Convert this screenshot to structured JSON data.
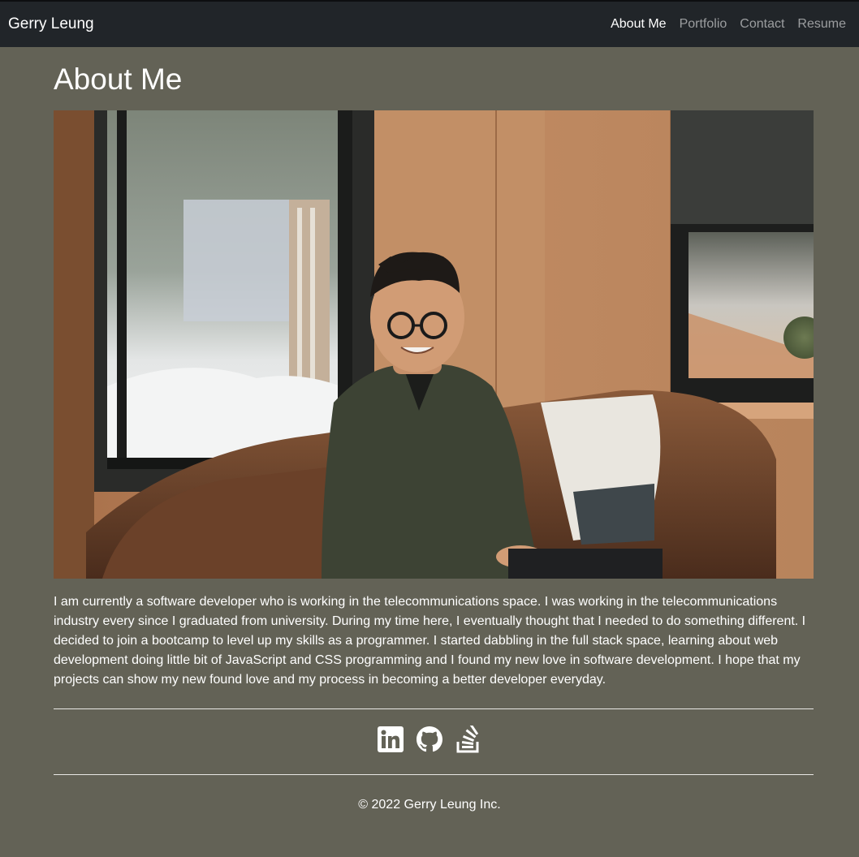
{
  "nav": {
    "brand": "Gerry Leung",
    "links": [
      {
        "label": "About Me"
      },
      {
        "label": "Portfolio"
      },
      {
        "label": "Contact"
      },
      {
        "label": "Resume"
      }
    ]
  },
  "main": {
    "title": "About Me",
    "bio": "I am currently a software developer who is working in the telecommunications space. I was working in the telecommunications industry every since I graduated from university. During my time here, I eventually thought that I needed to do something different. I decided to join a bootcamp to level up my skills as a programmer. I started dabbling in the full stack space, learning about web development doing little bit of JavaScript and CSS programming and I found my new love in software development. I hope that my projects can show my new found love and my process in becoming a better developer everyday."
  },
  "socials": [
    {
      "icon": "linkedin-icon"
    },
    {
      "icon": "github-icon"
    },
    {
      "icon": "stackoverflow-icon"
    }
  ],
  "footer": {
    "copyright": "© 2022 Gerry Leung Inc."
  },
  "colors": {
    "page_background": "#636256",
    "navbar_background": "#212529",
    "text": "#ffffff"
  }
}
